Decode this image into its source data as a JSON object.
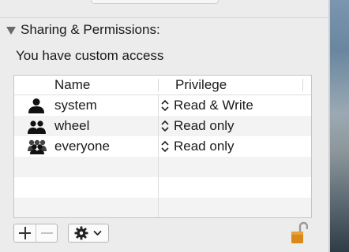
{
  "section": {
    "title": "Sharing & Permissions:",
    "access_text": "You have custom access"
  },
  "table": {
    "headers": {
      "name": "Name",
      "privilege": "Privilege"
    },
    "rows": [
      {
        "name": "system",
        "privilege": "Read & Write",
        "icon": "single-user-icon"
      },
      {
        "name": "wheel",
        "privilege": "Read only",
        "icon": "group-icon"
      },
      {
        "name": "everyone",
        "privilege": "Read only",
        "icon": "everyone-icon"
      }
    ]
  },
  "controls": {
    "add": "add-button",
    "remove": "remove-button",
    "action": "gear-menu-button",
    "lock": "lock-icon"
  },
  "colors": {
    "window_bg": "#ececec",
    "table_bg": "#ffffff",
    "row_alt": "#f3f3f3",
    "lock": "#d9891a"
  }
}
